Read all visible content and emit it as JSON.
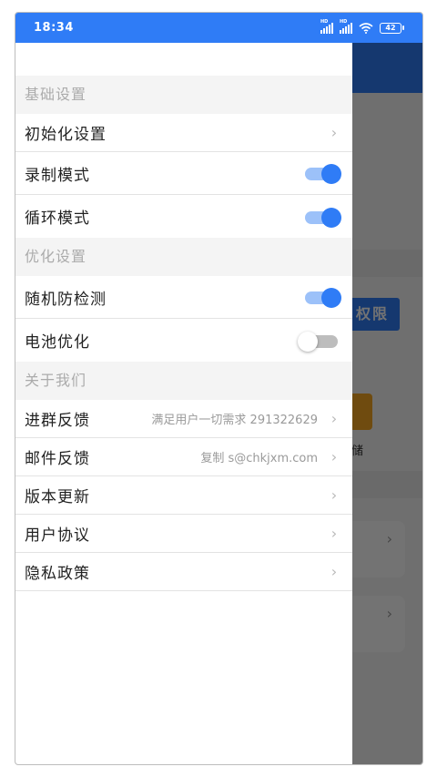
{
  "status_bar": {
    "time": "18:34",
    "battery": "42"
  },
  "background": {
    "permission_button": "权限",
    "storage_label": "字储"
  },
  "drawer": {
    "sections": {
      "basic": "基础设置",
      "optimize": "优化设置",
      "about": "关于我们"
    },
    "items": {
      "init_settings": "初始化设置",
      "record_mode": "录制模式",
      "loop_mode": "循环模式",
      "anti_detect": "随机防检测",
      "battery_opt": "电池优化",
      "join_group": "进群反馈",
      "join_group_extra": "满足用户一切需求 291322629",
      "email_feedback": "邮件反馈",
      "email_feedback_extra": "复制 s@chkjxm.com",
      "version_update": "版本更新",
      "user_agreement": "用户协议",
      "privacy_policy": "隐私政策"
    },
    "toggles": {
      "record_mode": true,
      "loop_mode": true,
      "anti_detect": true,
      "battery_opt": false
    }
  },
  "colors": {
    "accent": "#2f7cf6",
    "section_text": "#ababab"
  }
}
